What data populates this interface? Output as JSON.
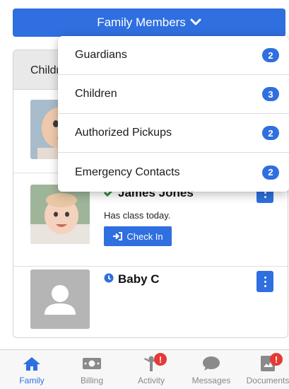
{
  "header": {
    "title": "Family Members"
  },
  "section": {
    "title": "Children"
  },
  "children": [
    {
      "name": "",
      "subtitle": ""
    },
    {
      "name": "James Jones",
      "subtitle": "Has class today.",
      "action": "Check In"
    },
    {
      "name": "Baby C"
    }
  ],
  "menu": {
    "items": [
      {
        "label": "Guardians",
        "count": "2"
      },
      {
        "label": "Children",
        "count": "3"
      },
      {
        "label": "Authorized Pickups",
        "count": "2"
      },
      {
        "label": "Emergency Contacts",
        "count": "2"
      }
    ]
  },
  "tabs": [
    {
      "label": "Family",
      "icon": "home-icon",
      "active": true
    },
    {
      "label": "Billing",
      "icon": "money-icon"
    },
    {
      "label": "Activity",
      "icon": "activity-icon",
      "alert": "!"
    },
    {
      "label": "Messages",
      "icon": "chat-icon"
    },
    {
      "label": "Documents",
      "icon": "document-icon",
      "alert": "!"
    }
  ],
  "colors": {
    "accent": "#2f6fdf",
    "alert": "#e53935",
    "success": "#2e8b3a"
  }
}
